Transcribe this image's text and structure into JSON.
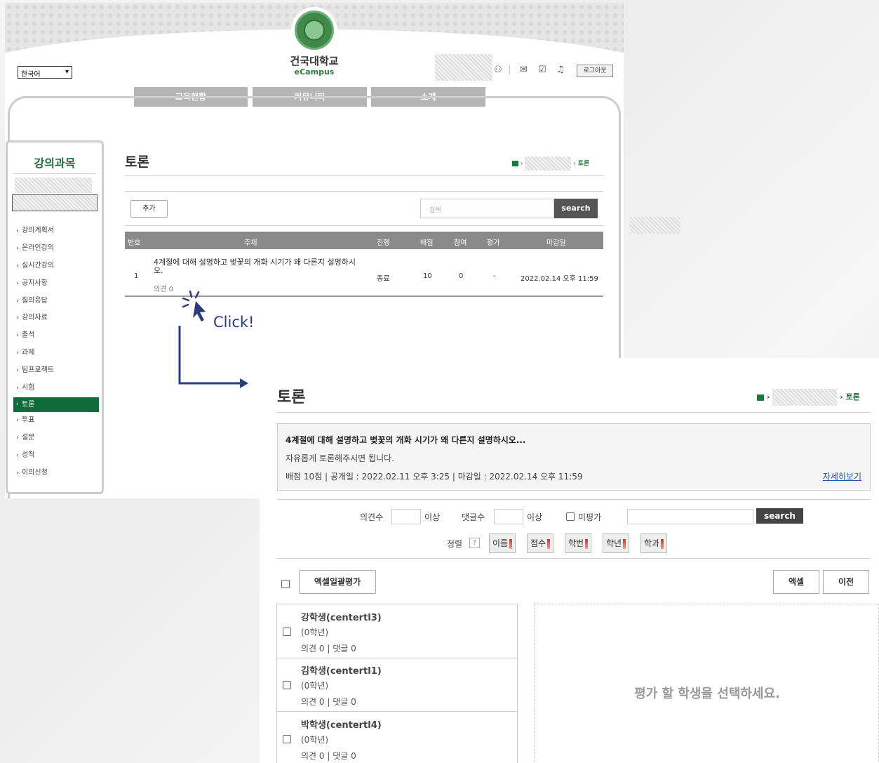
{
  "header": {
    "lang": "한국어",
    "univ_name": "건국대학교",
    "univ_sub": "eCampus",
    "logout": "로그아웃",
    "nav": [
      "교육현황",
      "커뮤니티",
      "소개"
    ]
  },
  "sidebar": {
    "title": "강의과목",
    "items": [
      "강의계획서",
      "온라인강의",
      "실시간강의",
      "공지사항",
      "질의응답",
      "강의자료",
      "출석",
      "과제",
      "팀프로젝트",
      "시험",
      "토론",
      "투표",
      "설문",
      "성적",
      "이의신청"
    ],
    "active": "토론"
  },
  "list_page": {
    "title": "토론",
    "breadcrumb_end": "토론",
    "add_label": "추가",
    "search_placeholder": "검색",
    "search_label": "search",
    "columns": [
      "번호",
      "주제",
      "진행",
      "배점",
      "참여",
      "평가",
      "마감일"
    ],
    "row": {
      "no": "1",
      "title": "4계절에 대해 설명하고 벚꽃의 개화 시기가 왜 다른지 설명하시오.",
      "sub": "의견 0",
      "status": "종료",
      "score": "10",
      "participants": "0",
      "evaluation": "-",
      "deadline": "2022.02.14 오후 11:59"
    }
  },
  "annotation": {
    "click": "Click!"
  },
  "detail_page": {
    "title": "토론",
    "breadcrumb_end": "토론",
    "topic": "4계절에 대해 설명하고 벚꽃의 개화 시기가 왜 다른지 설명하시오...",
    "description": "자유롭게 토론해주시면 됩니다.",
    "meta": "배점 10점 | 공개일 : 2022.02.11 오후 3:25 | 마감일 : 2022.02.14 오후 11:59",
    "more": "자세히보기",
    "filter": {
      "opinion_label": "의견수",
      "reply_label": "댓글수",
      "above": "이상",
      "unrated": "미평가",
      "search_label": "search",
      "sort_label": "정렬",
      "sort_help": "?",
      "sort_options": [
        "이름",
        "점수",
        "학번",
        "학년",
        "학과"
      ]
    },
    "bulk_label": "엑셀일괄평가",
    "excel_label": "엑셀",
    "prev_label": "이전",
    "students": [
      {
        "name": "강학생(centertl3)",
        "grade": "(0학년)",
        "counts": "의견 0 | 댓글 0"
      },
      {
        "name": "김학생(centertl1)",
        "grade": "(0학년)",
        "counts": "의견 0 | 댓글 0"
      },
      {
        "name": "박학생(centertl4)",
        "grade": "(0학년)",
        "counts": "의견 0 | 댓글 0"
      }
    ],
    "empty_message": "평가 할 학생을 선택하세요."
  },
  "colors": {
    "brand_green": "#0f6b3c",
    "arrow_blue": "#2c3a80"
  }
}
